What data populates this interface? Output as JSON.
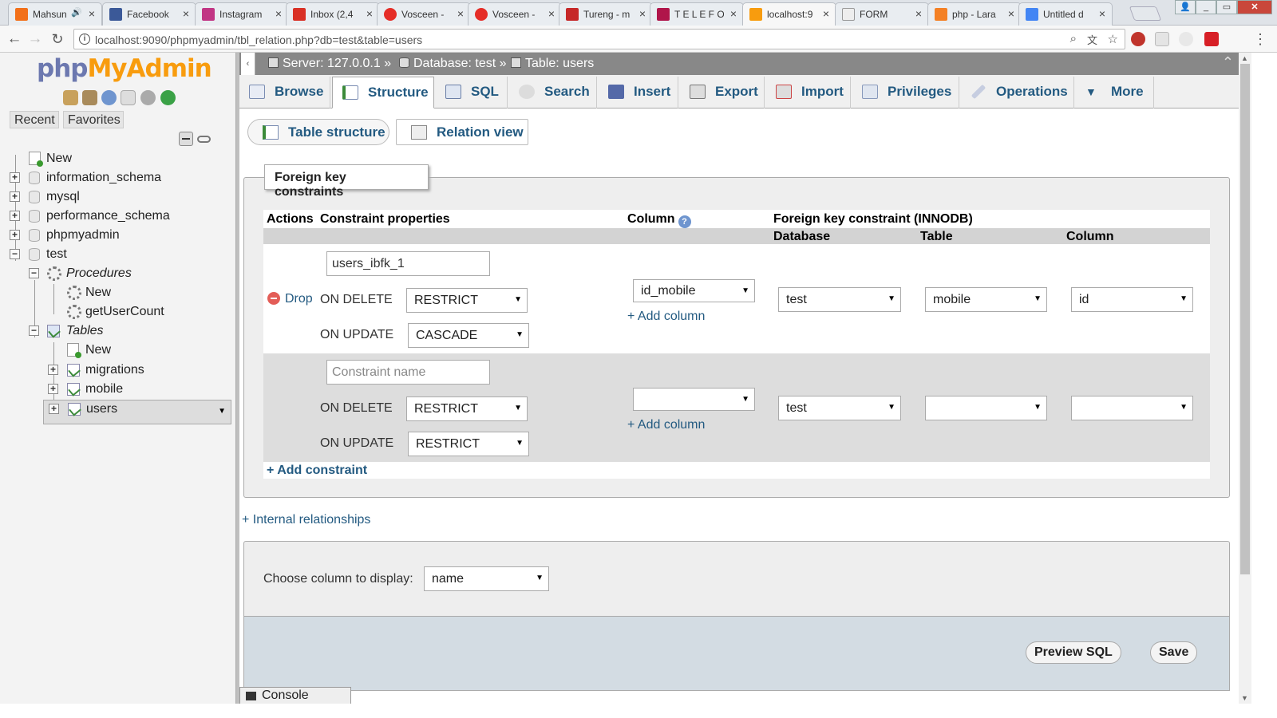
{
  "browser": {
    "tabs": [
      {
        "title": "Mahsun",
        "favicon_color": "#f2701a",
        "active": false
      },
      {
        "title": "Facebook",
        "favicon_color": "#3b5998",
        "active": false
      },
      {
        "title": "Instagram",
        "favicon_color": "#c13584",
        "active": false
      },
      {
        "title": "Inbox (2,4",
        "favicon_color": "#d93025",
        "active": false
      },
      {
        "title": "Vosceen -",
        "favicon_color": "#e52d27",
        "active": false
      },
      {
        "title": "Vosceen -",
        "favicon_color": "#e52d27",
        "active": false
      },
      {
        "title": "Tureng - m",
        "favicon_color": "#c62828",
        "active": false
      },
      {
        "title": "T E L E F O",
        "favicon_color": "#b0154a",
        "active": false
      },
      {
        "title": "localhost:9",
        "favicon_color": "#f89c0e",
        "active": true
      },
      {
        "title": "FORM",
        "favicon_color": "#9e9e9e",
        "active": false
      },
      {
        "title": "php - Lara",
        "favicon_color": "#f48024",
        "active": false
      },
      {
        "title": "Untitled d",
        "favicon_color": "#4285f4",
        "active": false
      }
    ],
    "url": "localhost:9090/phpmyadmin/tbl_relation.php?db=test&table=users"
  },
  "pma": {
    "logo_php": "php",
    "logo_myadmin": "MyAdmin",
    "recent": "Recent",
    "favorites": "Favorites",
    "tree": {
      "new": "New",
      "dbs": [
        "information_schema",
        "mysql",
        "performance_schema",
        "phpmyadmin",
        "test"
      ],
      "procedures": "Procedures",
      "proc_new": "New",
      "proc_item": "getUserCount",
      "tables": "Tables",
      "tables_new": "New",
      "table_items": [
        "migrations",
        "mobile",
        "users"
      ]
    },
    "breadcrumb": {
      "server": "Server: 127.0.0.1 »",
      "database": "Database: test »",
      "table": "Table: users"
    },
    "menu": [
      "Browse",
      "Structure",
      "SQL",
      "Search",
      "Insert",
      "Export",
      "Import",
      "Privileges",
      "Operations",
      "More"
    ],
    "subtabs": [
      "Table structure",
      "Relation view"
    ],
    "fk": {
      "legend": "Foreign key constraints",
      "h_actions": "Actions",
      "h_props": "Constraint properties",
      "h_column": "Column",
      "h_fk": "Foreign key constraint (INNODB)",
      "h_database": "Database",
      "h_table": "Table",
      "h_col2": "Column",
      "drop": "Drop",
      "on_delete": "ON DELETE",
      "on_update": "ON UPDATE",
      "add_column": "+ Add column",
      "add_constraint": "+ Add constraint",
      "row1": {
        "name": "users_ibfk_1",
        "on_delete": "RESTRICT",
        "on_update": "CASCADE",
        "column": "id_mobile",
        "database": "test",
        "table": "mobile",
        "ref_column": "id"
      },
      "row2": {
        "name_placeholder": "Constraint name",
        "on_delete": "RESTRICT",
        "on_update": "RESTRICT",
        "column": "",
        "database": "test",
        "table": "",
        "ref_column": ""
      }
    },
    "internal_relationships": "+ Internal relationships",
    "display": {
      "label": "Choose column to display:",
      "value": "name"
    },
    "buttons": {
      "preview_sql": "Preview SQL",
      "save": "Save"
    },
    "console": "Console"
  }
}
